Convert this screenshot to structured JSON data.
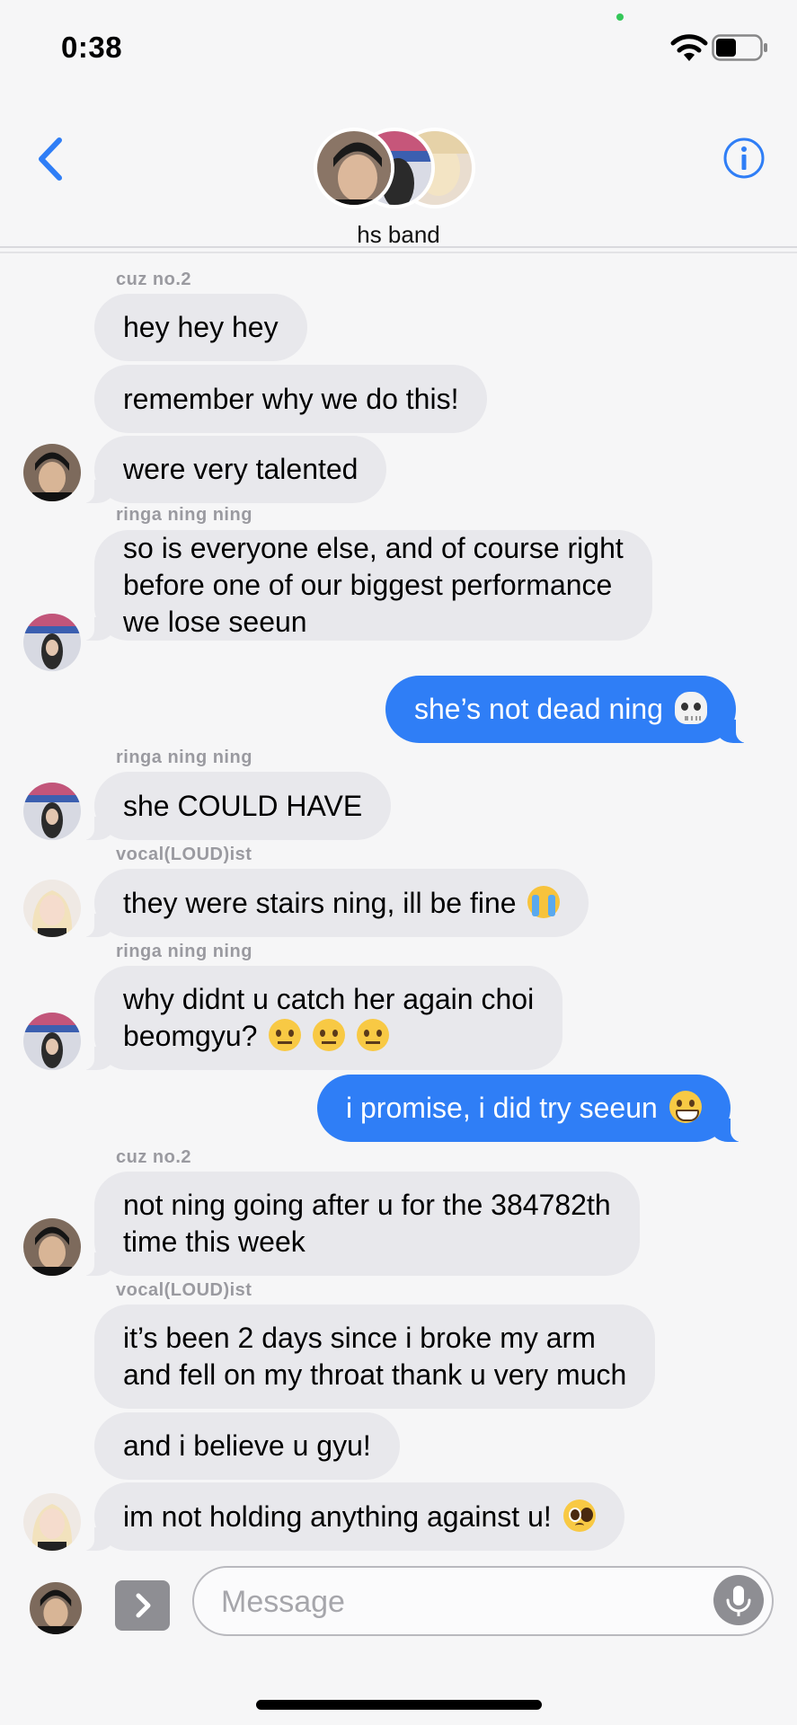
{
  "status_bar": {
    "time": "0:38"
  },
  "header": {
    "group_name": "hs band"
  },
  "messages": [
    {
      "sender": "cuz no.2",
      "text": "hey hey hey"
    },
    {
      "text": "remember why we do this!"
    },
    {
      "text": "were very talented"
    },
    {
      "sender": "ringa ning ning",
      "text": "so is everyone else, and of course right\nbefore one of our biggest performance\nwe lose seeun"
    },
    {
      "text": "she’s not dead ning",
      "emoji": "skull-icon"
    },
    {
      "sender": "ringa ning ning",
      "text": "she COULD HAVE"
    },
    {
      "sender": "vocal(LOUD)ist",
      "text": "they were stairs ning, ill be fine",
      "emoji": "loudly-crying-face-icon"
    },
    {
      "sender": "ringa ning ning",
      "text": "why didnt u catch her again choi\nbeomgyu?",
      "emoji": "raised-eyebrow-face-icon x3"
    },
    {
      "text": "i promise, i did try seeun",
      "emoji": "grinning-face-icon"
    },
    {
      "sender": "cuz no.2",
      "text": "not ning going after u for the 384782th\ntime this week"
    },
    {
      "sender": "vocal(LOUD)ist",
      "text": "it’s been 2 days since i broke my arm\nand fell on my throat thank u very much"
    },
    {
      "text": "and i believe u gyu!"
    },
    {
      "text": "im not holding anything against u!",
      "emoji": "pleading-face-icon"
    }
  ],
  "input": {
    "placeholder": "Message"
  },
  "colors": {
    "incoming_bubble": "#e8e8ec",
    "outgoing_bubble": "#2f7ef6",
    "accent": "#2f7ef6",
    "sender_name": "#9a9aa0"
  }
}
